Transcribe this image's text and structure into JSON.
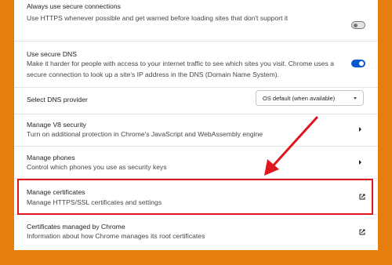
{
  "colors": {
    "frame_bg": "#e67e0f",
    "toggle_on": "#0b57d0",
    "highlight": "#e0161e",
    "arrow": "#e0161e"
  },
  "settings": {
    "secure_connections": {
      "title": "Always use secure connections",
      "description": "Use HTTPS whenever possible and get warned before loading sites that don't support it",
      "toggle": "off"
    },
    "secure_dns": {
      "title": "Use secure DNS",
      "description_line1": "Make it harder for people with access to your internet traffic to see which sites you visit. Chrome uses a",
      "description_line2": "secure connection to look up a site's IP address in the DNS (Domain Name System).",
      "toggle": "on"
    },
    "dns_provider": {
      "label": "Select DNS provider",
      "value": "OS default (when available)"
    },
    "v8_security": {
      "title": "Manage V8 security",
      "description": "Turn on additional protection in Chrome's JavaScript and WebAssembly engine",
      "icon": "chevron-right-icon"
    },
    "phones": {
      "title": "Manage phones",
      "description": "Control which phones you use as security keys",
      "icon": "chevron-right-icon"
    },
    "certificates": {
      "title": "Manage certificates",
      "description": "Manage HTTPS/SSL certificates and settings",
      "icon": "open-in-new-icon"
    },
    "chrome_certificates": {
      "title": "Certificates managed by Chrome",
      "description": "Information about how Chrome manages its root certificates",
      "icon": "open-in-new-icon"
    }
  }
}
